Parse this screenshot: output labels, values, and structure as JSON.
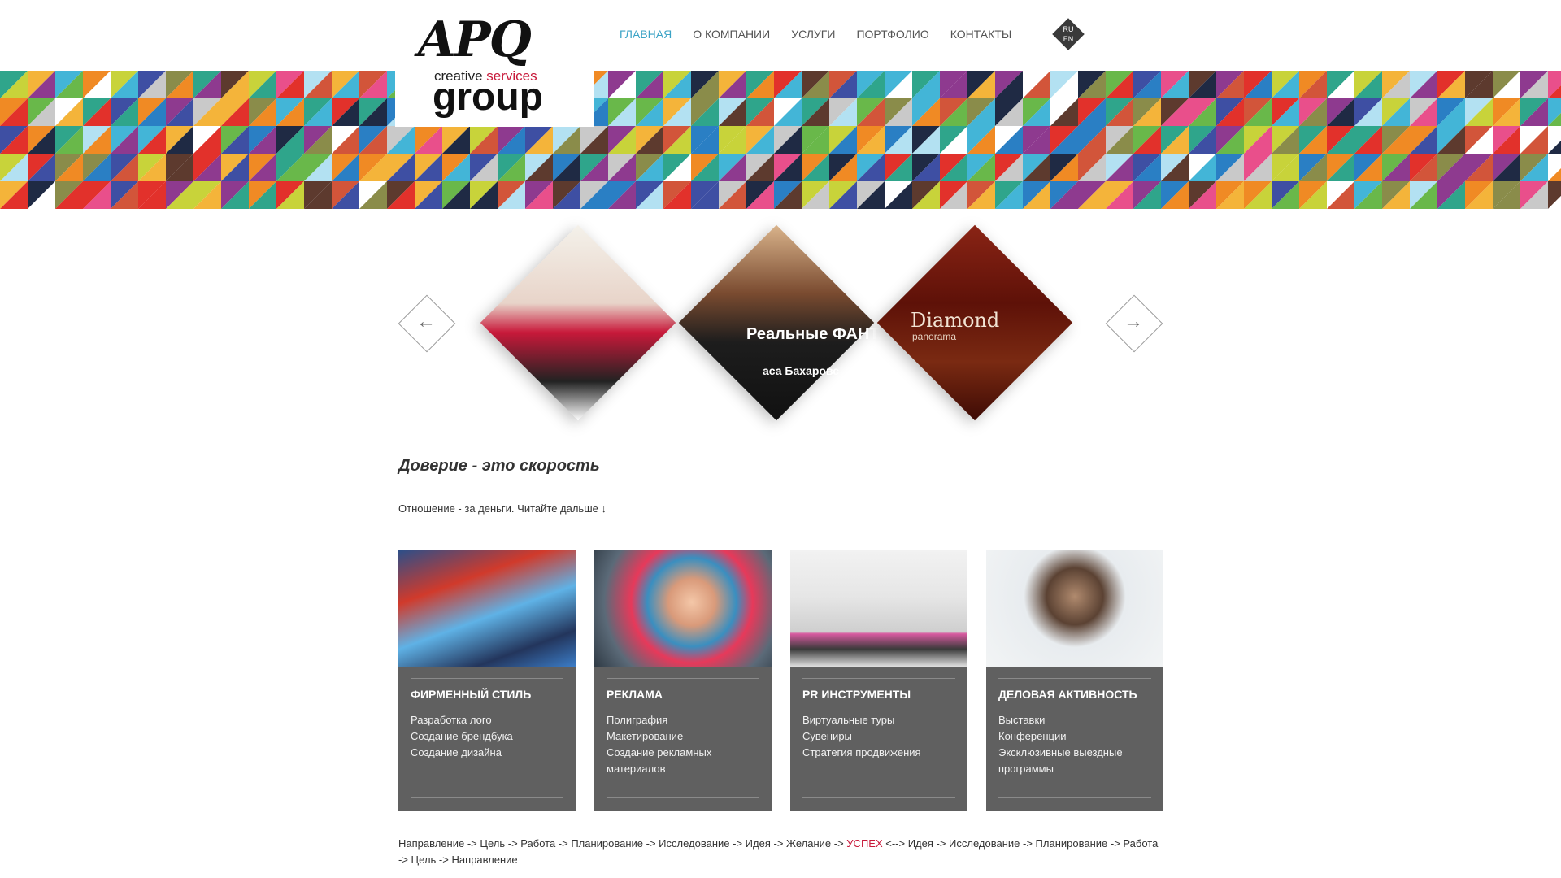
{
  "header": {
    "logo": {
      "apq": "APQ",
      "creative": "creative",
      "services": "services",
      "group": "group"
    },
    "nav": [
      {
        "label": "ГЛАВНАЯ",
        "active": true
      },
      {
        "label": "О КОМПАНИИ",
        "active": false
      },
      {
        "label": "УСЛУГИ",
        "active": false
      },
      {
        "label": "ПОРТФОЛИО",
        "active": false
      },
      {
        "label": "КОНТАКТЫ",
        "active": false
      }
    ],
    "lang": {
      "ru": "RU",
      "en": "EN"
    }
  },
  "slider": {
    "slides": [
      {
        "caption": "",
        "sub": ""
      },
      {
        "caption": "Реальные ФАНТАЗИИ",
        "sub": "аса Бахаровс"
      },
      {
        "caption": "Diamond",
        "sub": "panorama"
      }
    ],
    "prev_icon": "arrow-left-icon",
    "next_icon": "arrow-right-icon"
  },
  "main": {
    "headline": "Доверие - это скорость",
    "lead": "Отношение - за деньги. Читайте дальше ↓"
  },
  "cards": [
    {
      "title": "ФИРМЕННЫЙ СТИЛЬ",
      "items": [
        "Разработка лого",
        "Создание брендбука",
        "Создание дизайна"
      ]
    },
    {
      "title": "РЕКЛАМА",
      "items": [
        "Полиграфия",
        "Макетирование",
        "Создание рекламных",
        "материалов"
      ]
    },
    {
      "title": "PR ИНСТРУМЕНТЫ",
      "items": [
        "Виртуальные туры",
        "Сувениры",
        "Стратегия продвижения"
      ]
    },
    {
      "title": "ДЕЛОВАЯ АКТИВНОСТЬ",
      "items": [
        "Выставки",
        "Конференции",
        "Эксклюзивные выездные",
        "программы"
      ]
    }
  ],
  "chain": {
    "before": "Направление -> Цель -> Работа -> Планирование -> Исследование -> Идея -> Желание -> ",
    "highlight": "УСПЕХ",
    "after": " <--> Идея -> Исследование -> Планирование -> Работа -> Цель -> Направление"
  },
  "colors": {
    "accent_blue": "#3ba3c6",
    "accent_red": "#c8193a",
    "card_bg": "#606060"
  }
}
